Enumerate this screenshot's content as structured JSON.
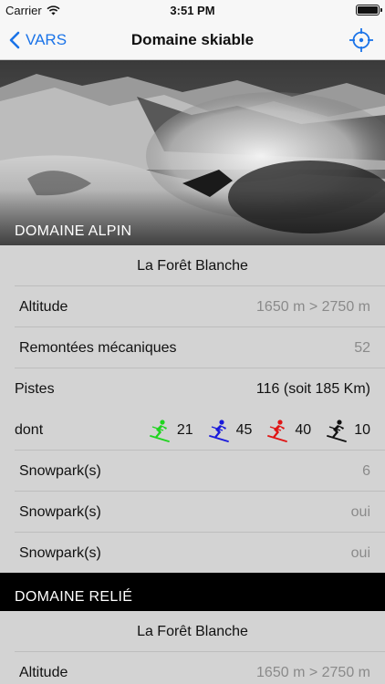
{
  "status": {
    "carrier": "Carrier",
    "time": "3:51 PM"
  },
  "nav": {
    "back_label": "VARS",
    "title": "Domaine skiable"
  },
  "hero": {
    "label": "DOMAINE ALPIN"
  },
  "alpine": {
    "name": "La Forêt Blanche",
    "altitude_label": "Altitude",
    "altitude_value": "1650 m > 2750 m",
    "lifts_label": "Remontées mécaniques",
    "lifts_value": "52",
    "slopes_label": "Pistes",
    "slopes_value": "116 (soit 185 Km)",
    "of_which_label": "dont",
    "slope_counts": [
      {
        "icon": "skier-green-icon",
        "color": "#1fd41f",
        "value": "21"
      },
      {
        "icon": "skier-blue-icon",
        "color": "#1a1adb",
        "value": "45"
      },
      {
        "icon": "skier-red-icon",
        "color": "#e01414",
        "value": "40"
      },
      {
        "icon": "skier-black-icon",
        "color": "#111111",
        "value": "10"
      }
    ],
    "snowpark1_label": "Snowpark(s)",
    "snowpark1_value": "6",
    "snowpark2_label": "Snowpark(s)",
    "snowpark2_value": "oui",
    "snowpark3_label": "Snowpark(s)",
    "snowpark3_value": "oui"
  },
  "linked": {
    "header": "DOMAINE RELIÉ",
    "name": "La Forêt Blanche",
    "altitude_label": "Altitude",
    "altitude_value": "1650 m > 2750 m"
  },
  "colors": {
    "accent": "#1a73e8",
    "section_bg": "#000000",
    "list_bg": "#d3d3d3"
  }
}
